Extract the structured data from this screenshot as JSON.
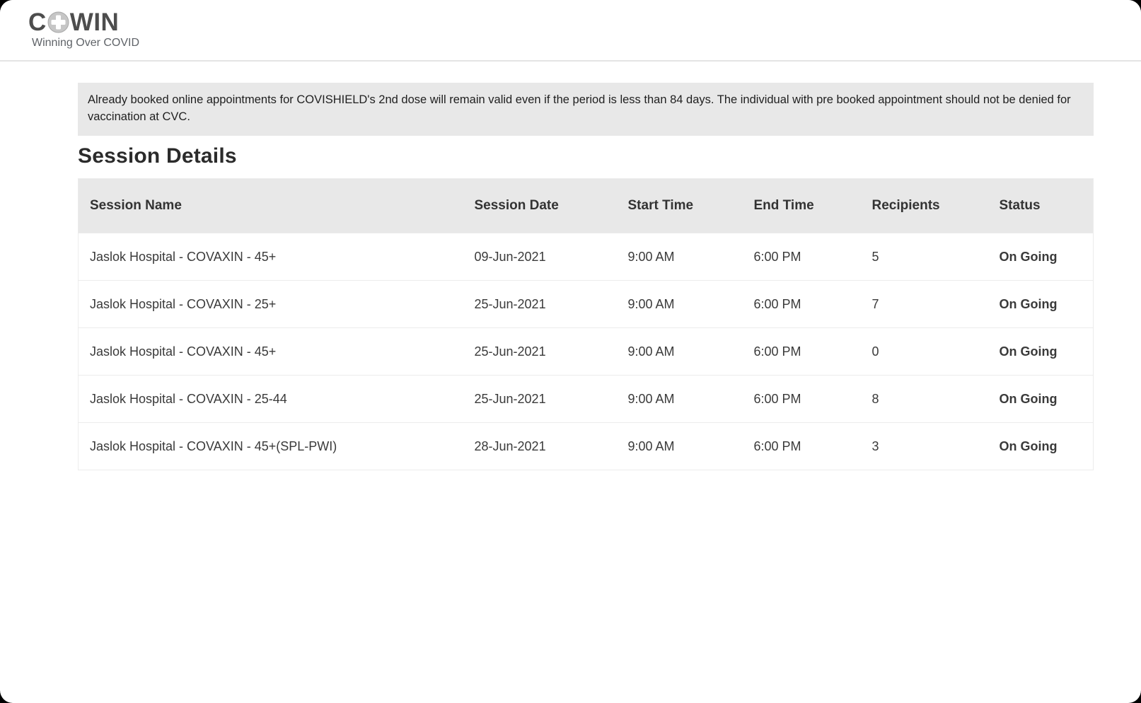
{
  "colors": {
    "notice_background": "#e8e8e8",
    "table_header_background": "#e8e8e8",
    "status_text": "#7a7a7a",
    "logo_gray": "#4d4d4d"
  },
  "header": {
    "logo_part1": "C",
    "logo_icon": "plus-circle-icon",
    "logo_part2": "WIN",
    "tagline": "Winning Over COVID"
  },
  "notice": {
    "text": "Already booked online appointments for COVISHIELD's 2nd dose will remain valid even if the period is less than 84 days. The individual with pre booked appointment should not be denied for vaccination at CVC."
  },
  "page": {
    "title": "Session Details"
  },
  "table": {
    "columns": [
      "Session Name",
      "Session Date",
      "Start Time",
      "End Time",
      "Recipients",
      "Status"
    ],
    "rows": [
      [
        "Jaslok Hospital - COVAXIN - 45+",
        "09-Jun-2021",
        "9:00 AM",
        "6:00 PM",
        "5",
        "On Going"
      ],
      [
        "Jaslok Hospital - COVAXIN - 25+",
        "25-Jun-2021",
        "9:00 AM",
        "6:00 PM",
        "7",
        "On Going"
      ],
      [
        "Jaslok Hospital - COVAXIN - 45+",
        "25-Jun-2021",
        "9:00 AM",
        "6:00 PM",
        "0",
        "On Going"
      ],
      [
        "Jaslok Hospital - COVAXIN - 25-44",
        "25-Jun-2021",
        "9:00 AM",
        "6:00 PM",
        "8",
        "On Going"
      ],
      [
        "Jaslok Hospital - COVAXIN - 45+(SPL-PWI)",
        "28-Jun-2021",
        "9:00 AM",
        "6:00 PM",
        "3",
        "On Going"
      ]
    ]
  }
}
